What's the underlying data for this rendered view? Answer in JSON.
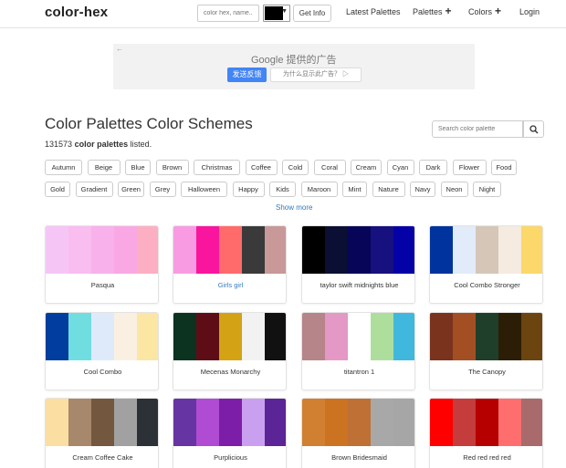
{
  "header": {
    "brand": "color-hex",
    "search_placeholder": "color hex, name..",
    "selected_color": "#000000",
    "get_info_label": "Get Info",
    "nav": [
      {
        "label": "Latest Palettes",
        "plus": ""
      },
      {
        "label": "Palettes",
        "plus": "+"
      },
      {
        "label": "Colors",
        "plus": "+"
      },
      {
        "label": "Login",
        "plus": ""
      }
    ]
  },
  "ad": {
    "back_icon": "arrow-left-icon",
    "google_text": "Google 提供的广告",
    "feedback_label": "发送反馈",
    "why_label": "为什么显示此广告？ ▷"
  },
  "main": {
    "title": "Color Palettes Color Schemes",
    "count": "131573",
    "count_bold": "color palettes",
    "count_suffix": " listed.",
    "search_placeholder": "Search color palette",
    "tags_row1": [
      "Autumn",
      "Beige",
      "Blue",
      "Brown",
      "Christmas",
      "Coffee",
      "Cold",
      "Coral",
      "Cream",
      "Cyan",
      "Dark",
      "Flower",
      "Food"
    ],
    "tags_row2": [
      "Gold",
      "Gradient",
      "Green",
      "Grey",
      "Halloween",
      "Happy",
      "Kids",
      "Maroon",
      "Mint",
      "Nature",
      "Navy",
      "Neon",
      "Night"
    ],
    "show_more": "Show more",
    "palettes": [
      {
        "name": "Pasqua",
        "link": false,
        "colors": [
          "#f5c6f5",
          "#f9bdf0",
          "#f8b1ea",
          "#f9a8e4",
          "#fcafc3"
        ]
      },
      {
        "name": "Girls girl",
        "link": true,
        "colors": [
          "#f99be2",
          "#f9159e",
          "#ff6b6b",
          "#3a3a3a",
          "#c99898"
        ]
      },
      {
        "name": "taylor swift midnights blue",
        "link": false,
        "colors": [
          "#000000",
          "#0a0f33",
          "#060558",
          "#17107f",
          "#0402a7"
        ]
      },
      {
        "name": "Cool Combo Stronger",
        "link": false,
        "colors": [
          "#00339d",
          "#e2ebfa",
          "#d6c6b8",
          "#f5ebe1",
          "#fbd869"
        ]
      },
      {
        "name": "Cool Combo",
        "link": false,
        "colors": [
          "#003d9f",
          "#70dde0",
          "#deeafa",
          "#f9f0e2",
          "#fbe6a3"
        ]
      },
      {
        "name": "Mecenas Monarchy",
        "link": false,
        "colors": [
          "#0b3320",
          "#5e0d17",
          "#d3a315",
          "#f2f2f2",
          "#111111"
        ]
      },
      {
        "name": "titantron 1",
        "link": false,
        "colors": [
          "#b5858a",
          "#e398c6",
          "#ffffff",
          "#aede9c",
          "#40b8dd"
        ]
      },
      {
        "name": "The Canopy",
        "link": false,
        "colors": [
          "#7a331d",
          "#a44f23",
          "#1f3f2b",
          "#2c1e06",
          "#6c4410"
        ]
      },
      {
        "name": "Cream Coffee Cake",
        "link": false,
        "colors": [
          "#fbdea2",
          "#a7886d",
          "#74573f",
          "#a1a1a1",
          "#2b3136"
        ]
      },
      {
        "name": "Purplicious",
        "link": false,
        "colors": [
          "#6634a3",
          "#b04bd4",
          "#7d1ea8",
          "#c9a0f0",
          "#5b2497"
        ]
      },
      {
        "name": "Brown Bridesmaid",
        "link": false,
        "colors": [
          "#d08030",
          "#cc7322",
          "#be7035",
          "#a8a8a8",
          "#a6a6a6"
        ]
      },
      {
        "name": "Red red red red",
        "link": false,
        "colors": [
          "#ff0000",
          "#c43c3c",
          "#b60000",
          "#ff6e6e",
          "#a86a6a"
        ]
      }
    ]
  }
}
